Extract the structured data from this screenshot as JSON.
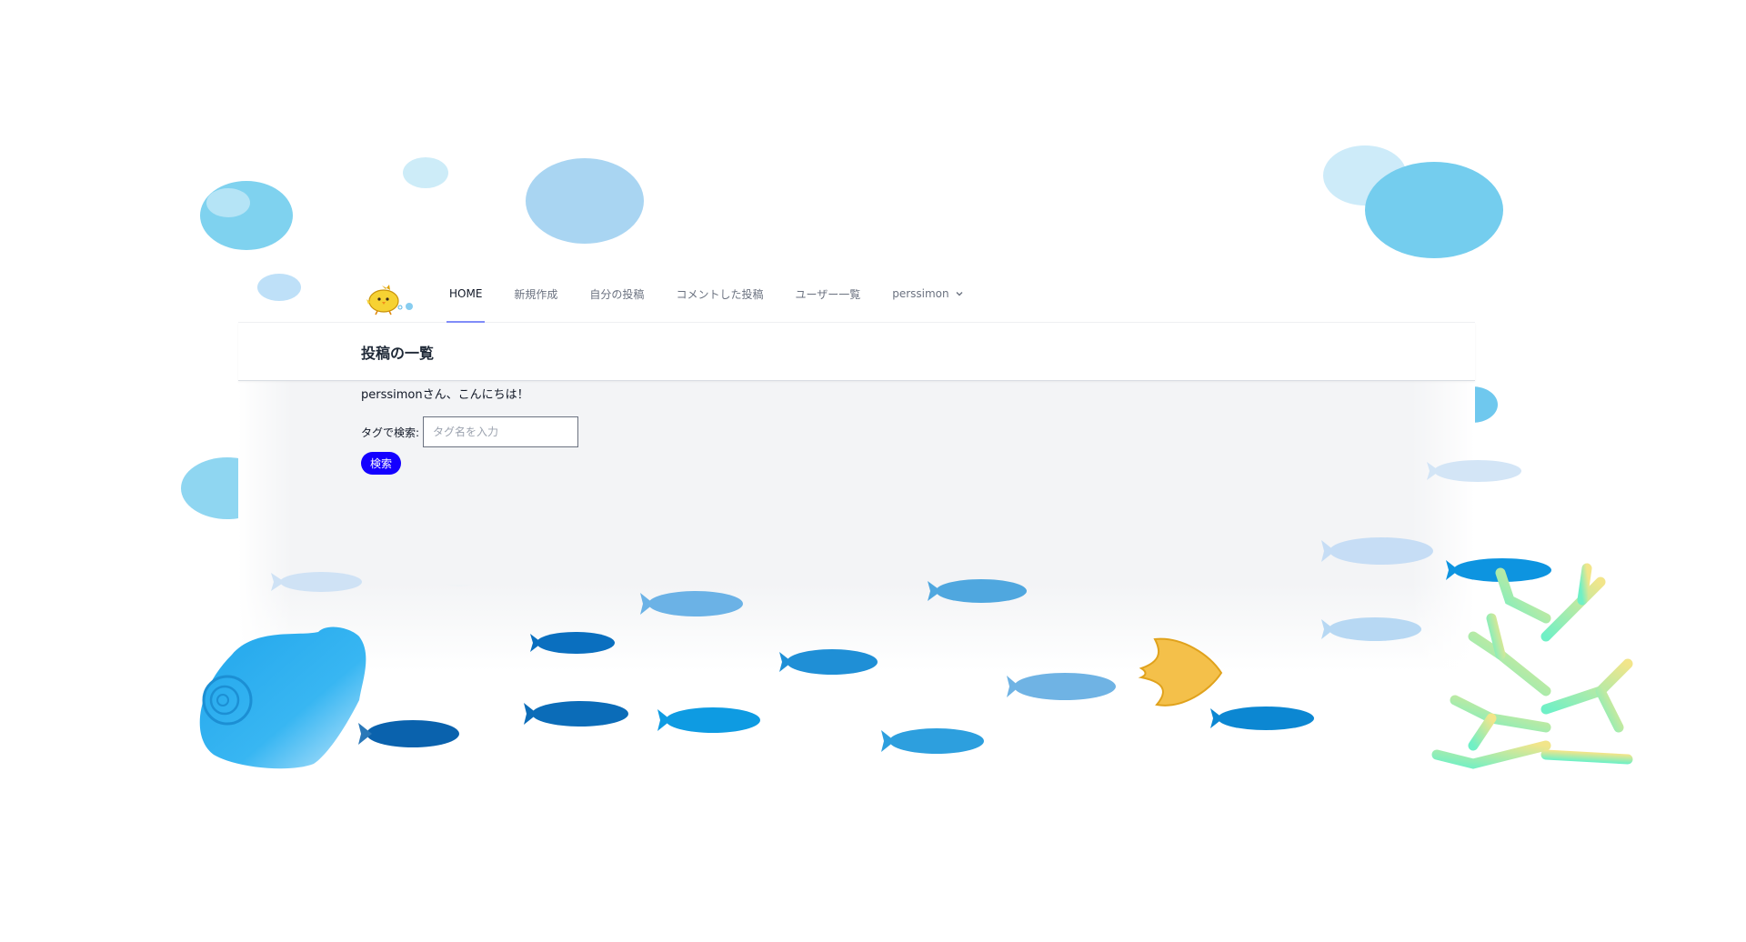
{
  "nav": {
    "logo_icon": "chick-logo-icon",
    "items": [
      {
        "label": "HOME",
        "active": true
      },
      {
        "label": "新規作成",
        "active": false
      },
      {
        "label": "自分の投稿",
        "active": false
      },
      {
        "label": "コメントした投稿",
        "active": false
      },
      {
        "label": "ユーザー一覧",
        "active": false
      }
    ],
    "user_menu": {
      "label": "perssimon",
      "icon": "chevron-down-icon"
    }
  },
  "header": {
    "title": "投稿の一覧"
  },
  "main": {
    "greeting": "perssimonさん、こんにちは！",
    "search": {
      "label": "タグで検索:",
      "placeholder": "タグ名を入力",
      "value": "",
      "button_label": "検索"
    }
  },
  "colors": {
    "accent": "#818cf8",
    "search_button": "#1400ff",
    "content_background": "#f3f4f6"
  }
}
